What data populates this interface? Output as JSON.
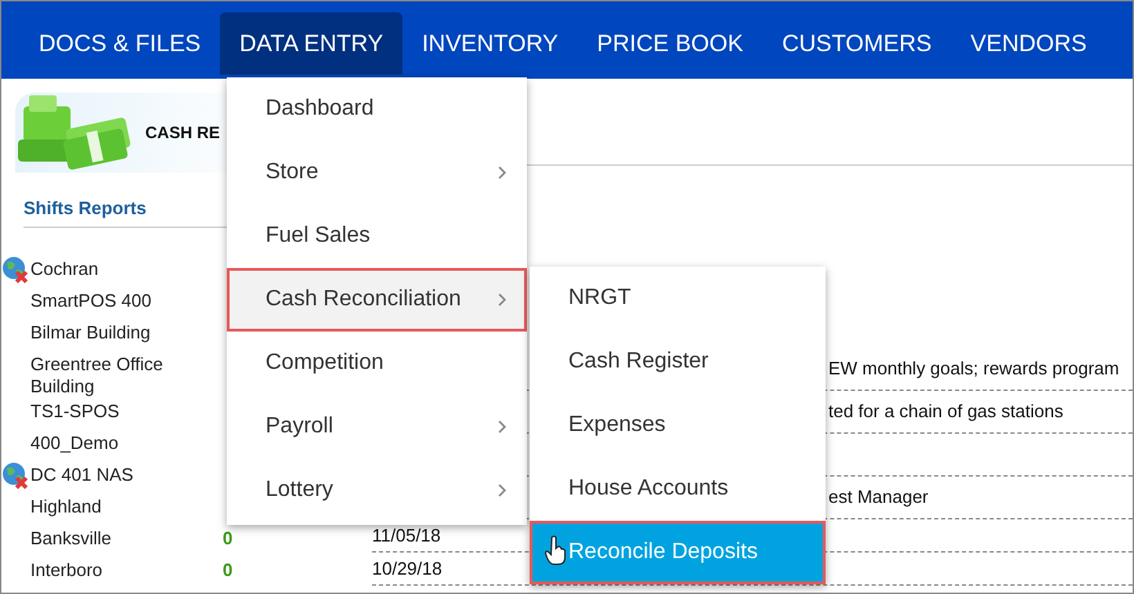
{
  "nav": [
    {
      "label": "DOCS & FILES",
      "selected": false
    },
    {
      "label": "DATA ENTRY",
      "selected": true
    },
    {
      "label": "INVENTORY",
      "selected": false
    },
    {
      "label": "PRICE BOOK",
      "selected": false
    },
    {
      "label": "CUSTOMERS",
      "selected": false
    },
    {
      "label": "VENDORS",
      "selected": false
    }
  ],
  "page": {
    "title": "CASH RE",
    "section": "Shifts Reports",
    "stores": [
      {
        "name": "Cochran",
        "offline": true
      },
      {
        "name": "SmartPOS 400",
        "offline": false
      },
      {
        "name": "Bilmar Building",
        "offline": false
      },
      {
        "name": "Greentree Office Building",
        "offline": false
      },
      {
        "name": "TS1-SPOS",
        "offline": false
      },
      {
        "name": "400_Demo",
        "offline": false
      },
      {
        "name": "DC 401 NAS",
        "offline": true
      },
      {
        "name": "Highland",
        "offline": false
      },
      {
        "name": "Banksville",
        "offline": false,
        "value": "0"
      },
      {
        "name": "Interboro",
        "offline": false,
        "value": "0"
      }
    ],
    "rows": [
      {
        "text": "EW monthly goals; rewards program"
      },
      {
        "text": "ted for a chain of gas stations"
      },
      {},
      {
        "text": "est Manager"
      },
      {
        "date": "11/05/18"
      },
      {
        "date": "10/29/18"
      }
    ]
  },
  "menu": {
    "items": [
      {
        "label": "Dashboard",
        "has_submenu": false,
        "selected": false
      },
      {
        "label": "Store",
        "has_submenu": true,
        "selected": false
      },
      {
        "label": "Fuel Sales",
        "has_submenu": false,
        "selected": false
      },
      {
        "label": "Cash Reconciliation",
        "has_submenu": true,
        "selected": true
      },
      {
        "label": "Competition",
        "has_submenu": false,
        "selected": false
      },
      {
        "label": "Payroll",
        "has_submenu": true,
        "selected": false
      },
      {
        "label": "Lottery",
        "has_submenu": true,
        "selected": false
      }
    ]
  },
  "submenu": {
    "items": [
      {
        "label": "NRGT",
        "selected": false
      },
      {
        "label": "Cash Register",
        "selected": false
      },
      {
        "label": "Expenses",
        "selected": false
      },
      {
        "label": "House Accounts",
        "selected": false
      },
      {
        "label": "Reconcile Deposits",
        "selected": true
      }
    ]
  }
}
